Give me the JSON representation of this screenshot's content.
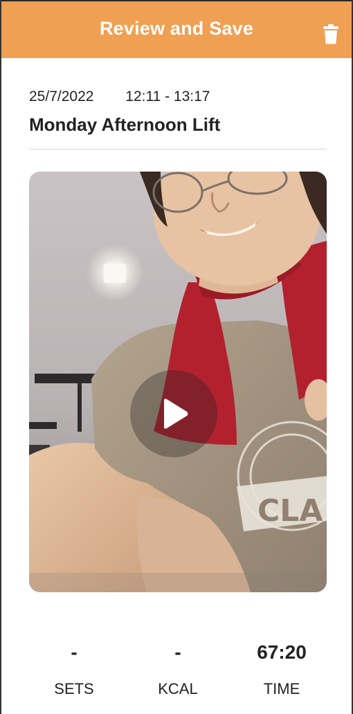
{
  "header": {
    "title": "Review and Save",
    "delete_icon": "trash-icon",
    "background_color": "#f0a052"
  },
  "workout": {
    "date": "25/7/2022",
    "time_range": "12:11 - 13:17",
    "title": "Monday Afternoon Lift"
  },
  "media": {
    "type": "video",
    "play_icon": "play-icon"
  },
  "stats": [
    {
      "value": "-",
      "label": "SETS"
    },
    {
      "value": "-",
      "label": "KCAL"
    },
    {
      "value": "67:20",
      "label": "TIME"
    }
  ]
}
